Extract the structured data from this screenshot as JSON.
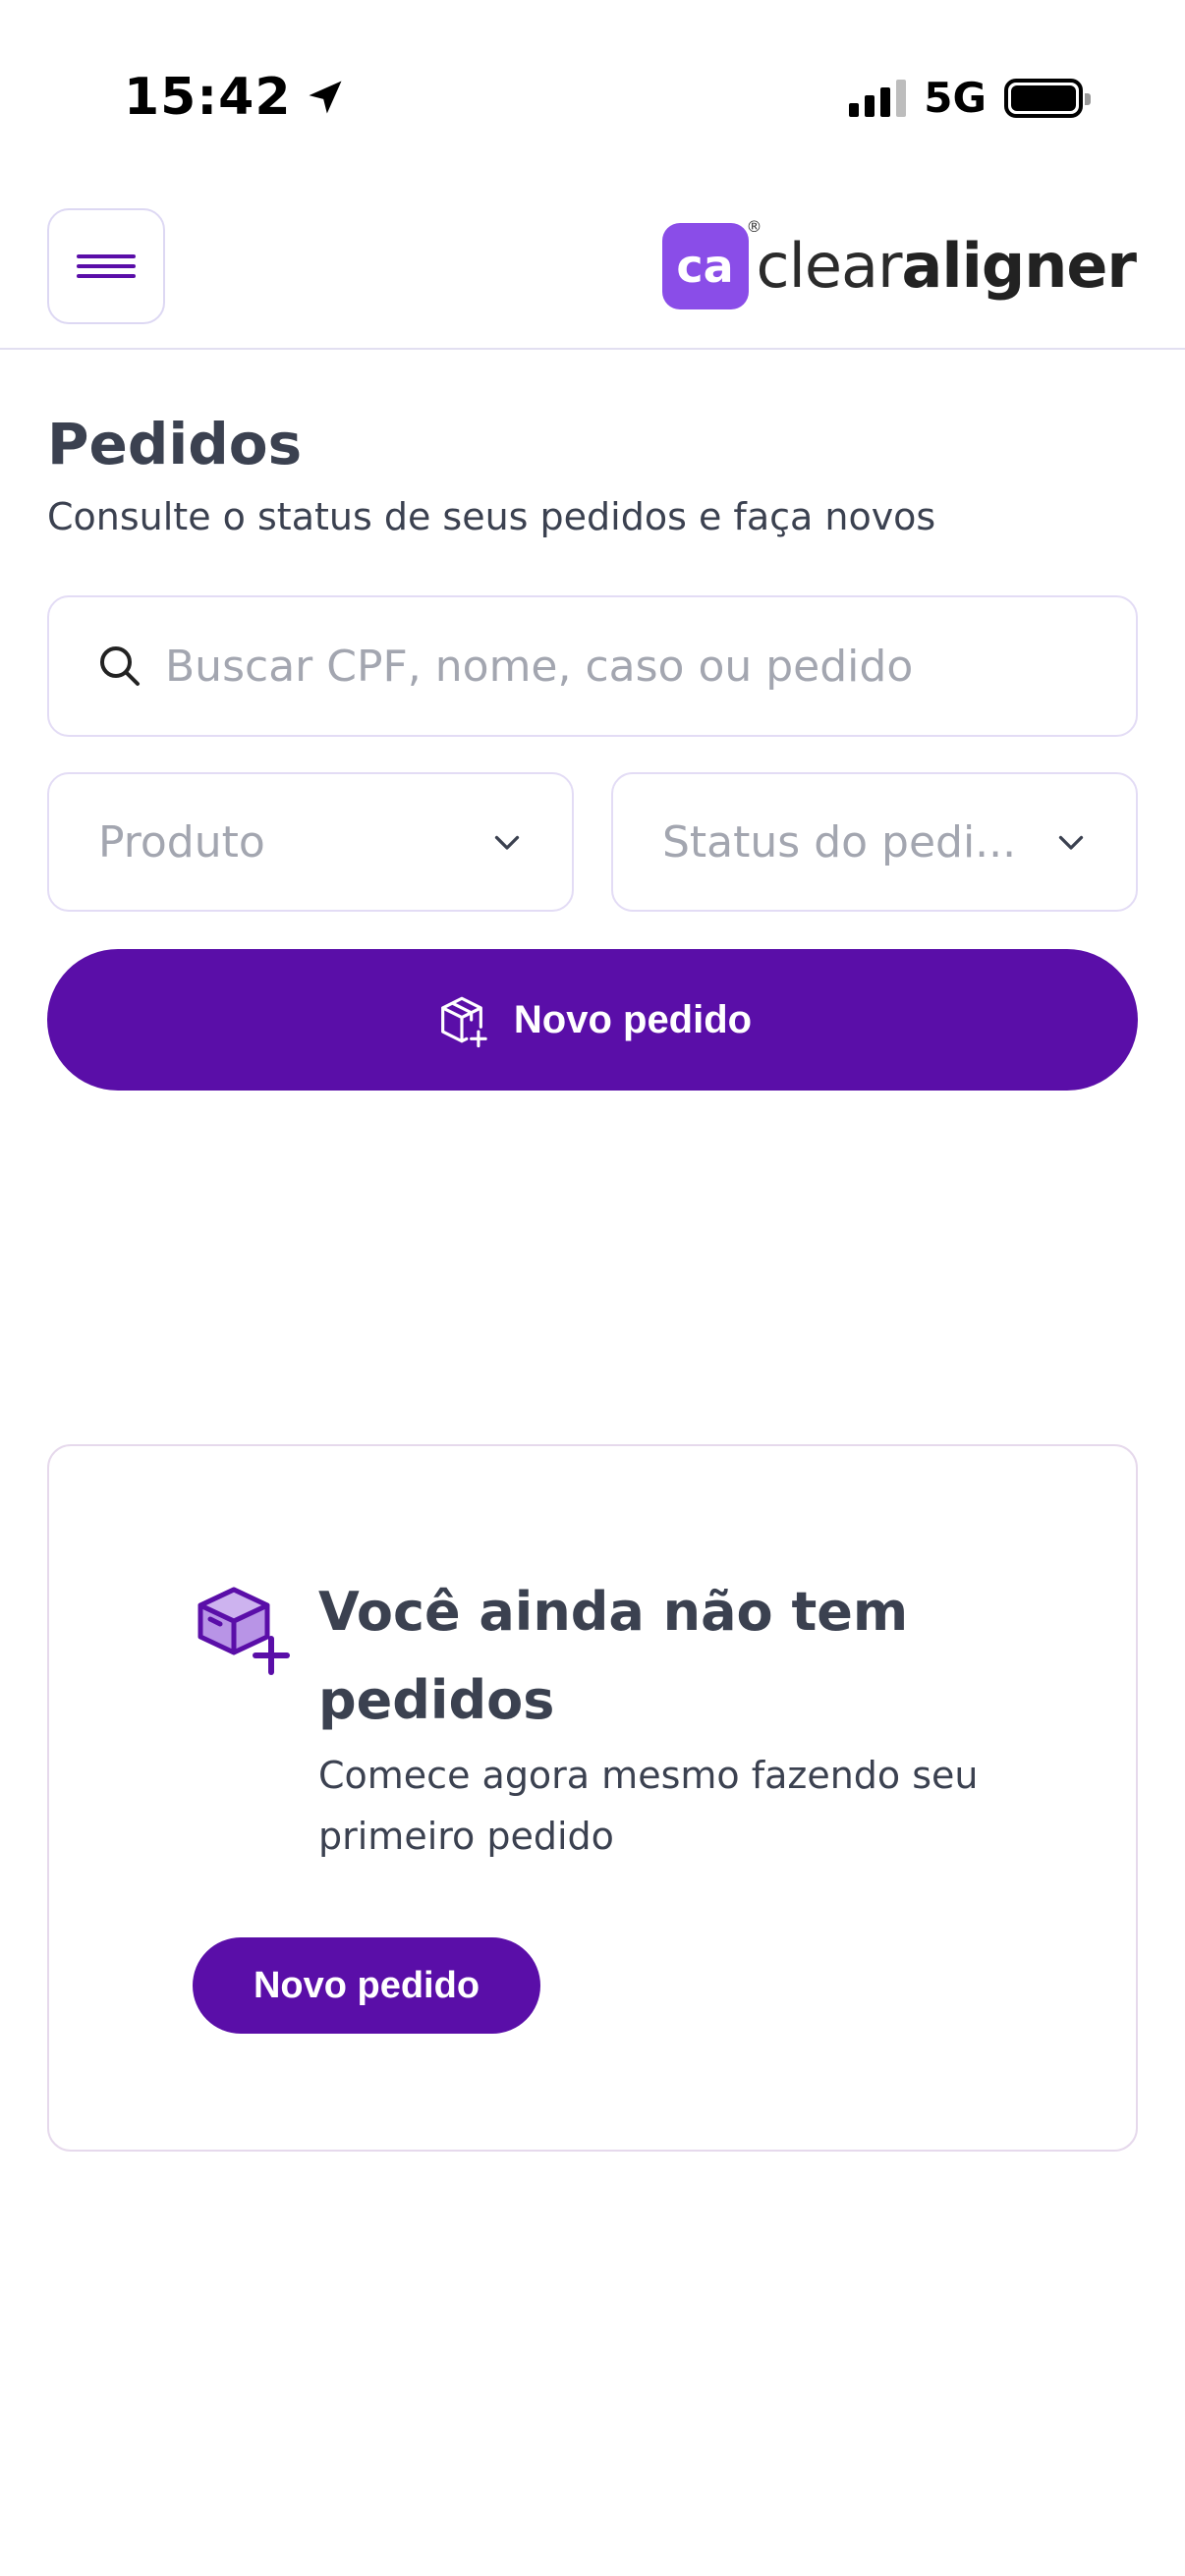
{
  "status_bar": {
    "time": "15:42",
    "network": "5G"
  },
  "header": {
    "logo_mark": "ca",
    "logo_text_light": "clear",
    "logo_text_bold": "aligner"
  },
  "page": {
    "title": "Pedidos",
    "subtitle": "Consulte o status de seus pedidos e faça novos"
  },
  "search": {
    "placeholder": "Buscar CPF, nome, caso ou pedido",
    "value": ""
  },
  "filters": {
    "product_label": "Produto",
    "status_label": "Status do pedi..."
  },
  "actions": {
    "new_order_label": "Novo pedido"
  },
  "empty_state": {
    "title": "Você ainda não tem pedidos",
    "description": "Comece agora mesmo fazendo seu primeiro pedido",
    "button_label": "Novo pedido"
  },
  "colors": {
    "primary": "#5a0ea8",
    "logo_mark_bg": "#8a4de8",
    "text": "#3b4150",
    "placeholder": "#a3a6b0",
    "border": "#e3dcf5"
  },
  "icons": {
    "location": "location-arrow-icon",
    "menu": "hamburger-menu-icon",
    "search": "search-icon",
    "chevron": "chevron-down-icon",
    "box_plus": "box-plus-icon"
  }
}
